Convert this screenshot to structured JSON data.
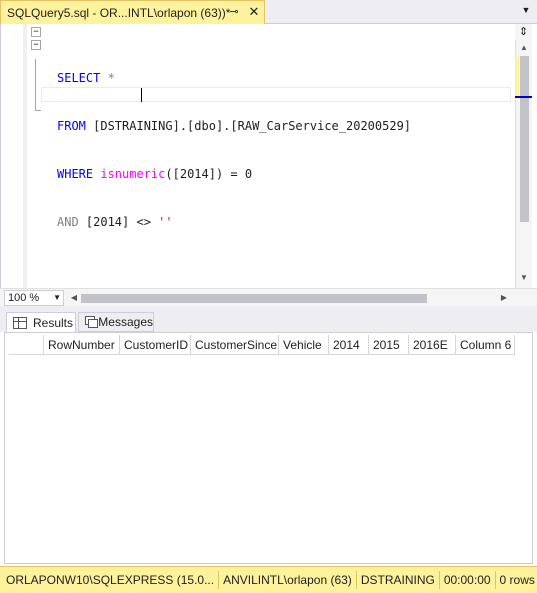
{
  "tab": {
    "title": "SQLQuery5.sql - OR...INTL\\orlapon (63))*",
    "pin_icon": "pin-icon",
    "close_icon": "close-icon",
    "dropdown_icon": "chevron-down-icon"
  },
  "editor": {
    "lines": [
      {
        "t1": "SELECT",
        "t2": " *"
      },
      {
        "t1": "FROM",
        "t2": " [DSTRAINING].[dbo].[RAW_CarService_20200529]"
      },
      {
        "t1": "WHERE",
        "t2": " ",
        "t3": "isnumeric",
        "t4": "([2014]) = 0"
      },
      {
        "t1": "AND",
        "t2": " [2014] <> ",
        "t3": "''"
      }
    ]
  },
  "zoom": {
    "value": "100 %"
  },
  "results_tabs": {
    "results": "Results",
    "messages": "Messages"
  },
  "grid": {
    "columns": [
      "RowNumber",
      "CustomerID",
      "CustomerSince",
      "Vehicle",
      "2014",
      "2015",
      "2016E",
      "Column 6"
    ]
  },
  "status": {
    "server": "ORLAPONW10\\SQLEXPRESS (15.0...",
    "user": "ANVILINTL\\orlapon (63)",
    "database": "DSTRAINING",
    "elapsed": "00:00:00",
    "rows": "0 rows"
  },
  "colors": {
    "accent": "#fff29d",
    "keyword": "#0000ff",
    "function": "#ff00ff",
    "string": "#ff0000",
    "operator": "#808080"
  }
}
